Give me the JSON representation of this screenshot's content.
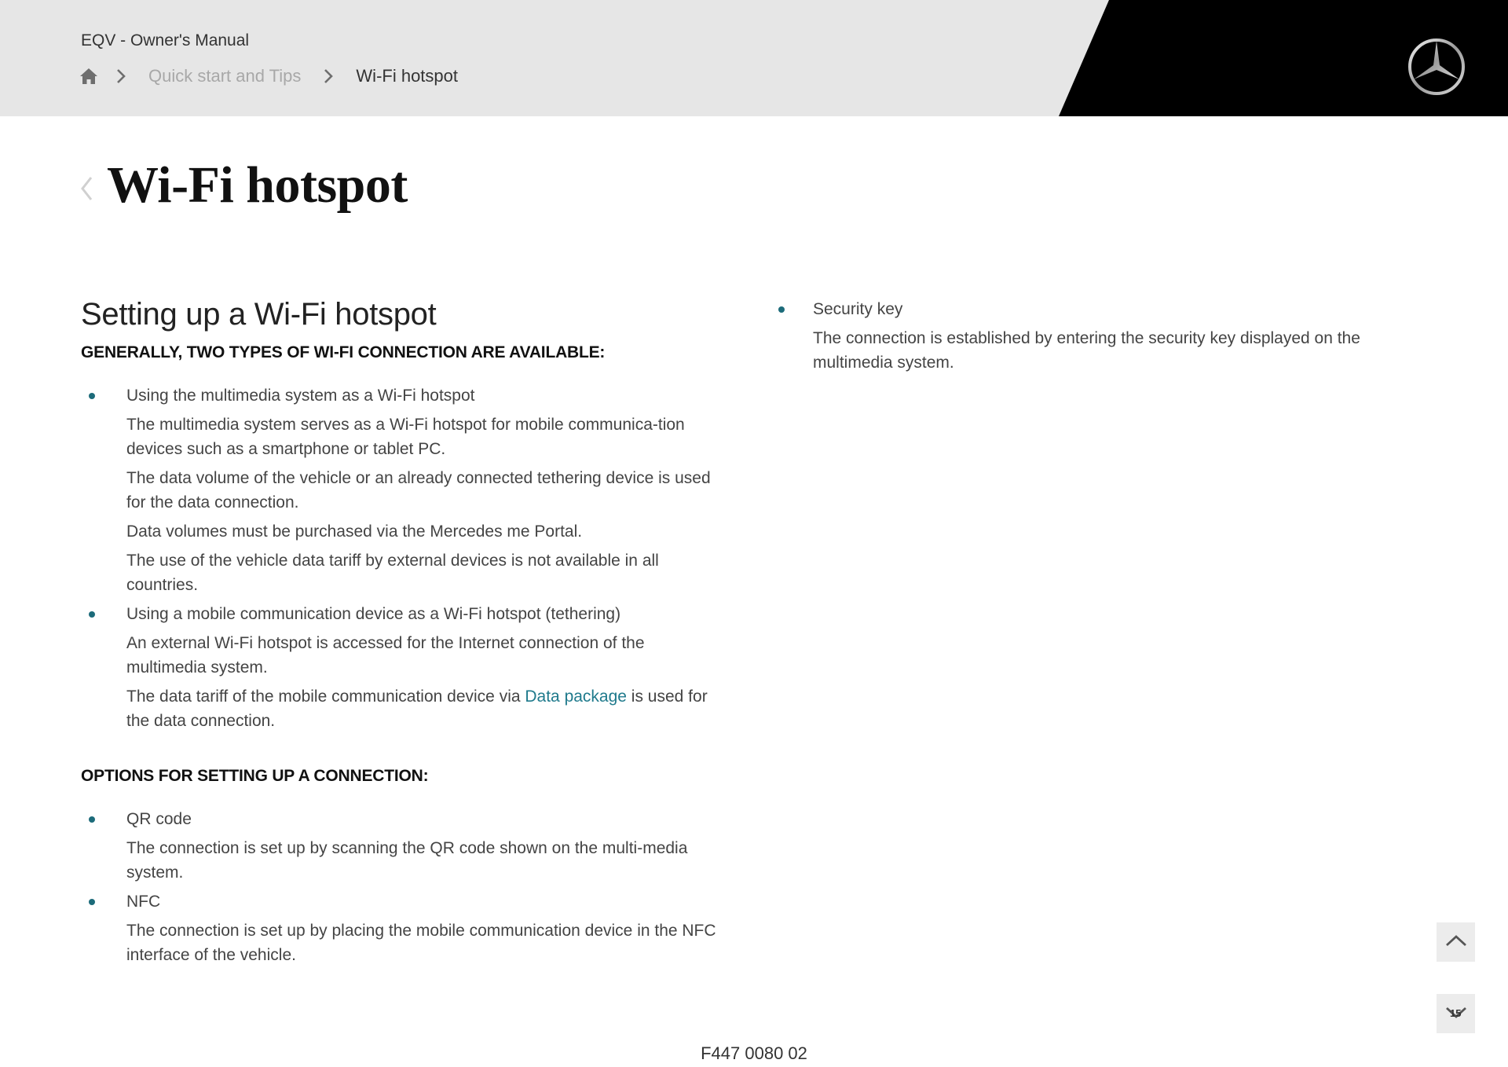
{
  "header": {
    "manual_title": "EQV - Owner's Manual",
    "breadcrumb": {
      "home_icon": "home-icon",
      "separator_icon": "chevron-right-icon",
      "items": [
        {
          "label": "Quick start and Tips",
          "link": true
        },
        {
          "label": "Wi-Fi hotspot",
          "link": false
        }
      ]
    },
    "logo": "mercedes-star-logo",
    "colors": {
      "bar": "#e6e6e6",
      "brand_panel": "#000000"
    }
  },
  "page": {
    "back_icon": "chevron-left-icon",
    "title": "Wi-Fi hotspot"
  },
  "content": {
    "section_heading": "Setting up a Wi-Fi hotspot",
    "connection_types": {
      "heading": "GENERALLY, TWO TYPES OF WI-FI CONNECTION ARE AVAILABLE:",
      "items": [
        {
          "title": "Using the multimedia system as a Wi-Fi hotspot",
          "paragraphs": [
            "The multimedia system serves as a Wi-Fi hotspot for mobile communica-tion devices such as a smartphone or tablet PC.",
            "The data volume of the vehicle or an already connected tethering device is used for the data connection.",
            "Data volumes must be purchased via the Mercedes me Portal.",
            "The use of the vehicle data tariff by external devices is not available in all countries."
          ]
        },
        {
          "title": "Using a mobile communication device as a Wi-Fi hotspot (tethering)",
          "paragraphs": [
            "An external Wi-Fi hotspot is accessed for the Internet connection of the multimedia system."
          ],
          "link_paragraph": {
            "before": "The data tariff of the mobile communication device via ",
            "link": "Data package",
            "after": " is used for the data connection."
          }
        }
      ]
    },
    "setup_options": {
      "heading": "OPTIONS FOR SETTING UP A CONNECTION:",
      "items": [
        {
          "title": "QR code",
          "paragraph": "The connection is set up by scanning the QR code shown on the multi-media system."
        },
        {
          "title": "NFC",
          "paragraph": "The connection is set up by placing the mobile communication device in the NFC interface of the vehicle."
        },
        {
          "title": "Security key",
          "paragraph": "The connection is established by entering the security key displayed on the multimedia system."
        }
      ]
    },
    "colors": {
      "bullet": "#1c6b7a",
      "link": "#1f7a8c"
    }
  },
  "controls": {
    "scroll_up_icon": "chevron-up-icon",
    "scroll_down_icon": "chevron-down-icon",
    "page_number": "15"
  },
  "footer": {
    "code": "F447 0080 02"
  }
}
